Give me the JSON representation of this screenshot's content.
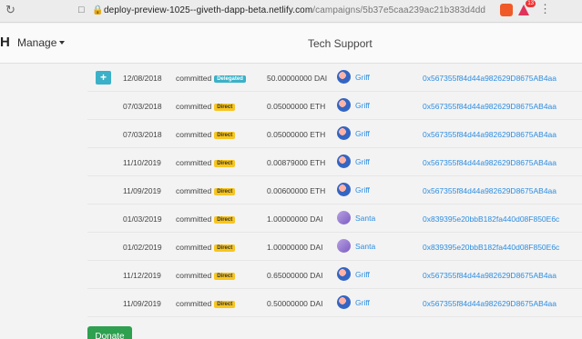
{
  "browser": {
    "url_host": "deploy-preview-1025--giveth-dapp-beta.netlify.com",
    "url_path": "/campaigns/5b37e5caa239ac21b383d4dd",
    "badge_count": "13"
  },
  "header": {
    "brand": "H",
    "manage_label": "Manage",
    "title": "Tech Support"
  },
  "table": {
    "rows": [
      {
        "date": "12/08/2018",
        "status": "committed",
        "tag": "Delegated",
        "amount": "50.00000000 DAI",
        "user": "Griff",
        "address": "0x567355f84d44a982629D8675AB4aa",
        "expandable": true
      },
      {
        "date": "07/03/2018",
        "status": "committed",
        "tag": "Direct",
        "amount": "0.05000000 ETH",
        "user": "Griff",
        "address": "0x567355f84d44a982629D8675AB4aa"
      },
      {
        "date": "07/03/2018",
        "status": "committed",
        "tag": "Direct",
        "amount": "0.05000000 ETH",
        "user": "Griff",
        "address": "0x567355f84d44a982629D8675AB4aa"
      },
      {
        "date": "11/10/2019",
        "status": "committed",
        "tag": "Direct",
        "amount": "0.00879000 ETH",
        "user": "Griff",
        "address": "0x567355f84d44a982629D8675AB4aa"
      },
      {
        "date": "11/09/2019",
        "status": "committed",
        "tag": "Direct",
        "amount": "0.00600000 ETH",
        "user": "Griff",
        "address": "0x567355f84d44a982629D8675AB4aa"
      },
      {
        "date": "01/03/2019",
        "status": "committed",
        "tag": "Direct",
        "amount": "1.00000000 DAI",
        "user": "Santa",
        "address": "0x839395e20bbB182fa440d08F850E6c"
      },
      {
        "date": "01/02/2019",
        "status": "committed",
        "tag": "Direct",
        "amount": "1.00000000 DAI",
        "user": "Santa",
        "address": "0x839395e20bbB182fa440d08F850E6c"
      },
      {
        "date": "11/12/2019",
        "status": "committed",
        "tag": "Direct",
        "amount": "0.65000000 DAI",
        "user": "Griff",
        "address": "0x567355f84d44a982629D8675AB4aa"
      },
      {
        "date": "11/09/2019",
        "status": "committed",
        "tag": "Direct",
        "amount": "0.50000000 DAI",
        "user": "Griff",
        "address": "0x567355f84d44a982629D8675AB4aa"
      }
    ],
    "expand_symbol": "+"
  },
  "donate_label": "Donate",
  "colors": {
    "link": "#2d8de0",
    "direct_tag": "#f7c520",
    "delegated_tag": "#3ab1c8",
    "donate": "#2ea04f"
  }
}
